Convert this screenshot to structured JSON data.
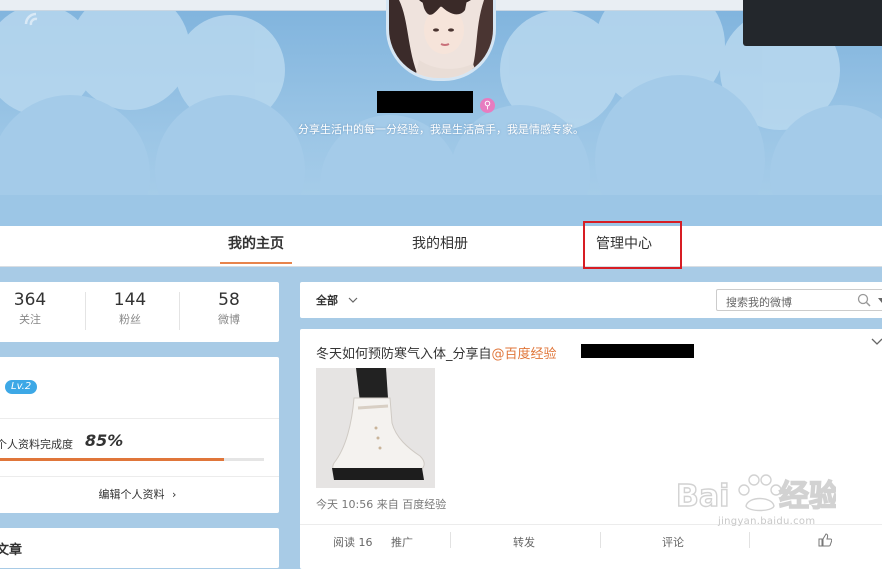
{
  "cover": {
    "bio": "分享生活中的每一分经验，我是生活高手，我是情感专家。"
  },
  "nav": {
    "tabs": [
      {
        "label": "我的主页",
        "active": true
      },
      {
        "label": "我的相册",
        "active": false
      },
      {
        "label": "管理中心",
        "active": false,
        "highlighted": true
      }
    ]
  },
  "stats": [
    {
      "value": "364",
      "label": "关注"
    },
    {
      "value": "144",
      "label": "粉丝"
    },
    {
      "value": "58",
      "label": "微博"
    }
  ],
  "profile": {
    "level": "Lv.2",
    "completion_label": "个人资料完成度",
    "completion_value": "85%",
    "completion_fraction": 0.85,
    "edit_label": "编辑个人资料"
  },
  "articles": {
    "title": "文章"
  },
  "feed": {
    "filter_label": "全部",
    "search_placeholder": "搜索我的微博"
  },
  "post": {
    "title": "冬天如何预防寒气入体_分享自",
    "mention": "@百度经验",
    "meta": "今天 10:56 来自 百度经验",
    "actions": {
      "read": "阅读 16",
      "promote": "推广",
      "forward": "转发",
      "comment": "评论"
    }
  },
  "watermark": {
    "url": "jingyan.baidu.com"
  },
  "colors": {
    "accent": "#e0763a",
    "highlight_box": "#d71d24",
    "level_badge": "#3da8e6",
    "cover_sky": "#8ec0e4"
  }
}
